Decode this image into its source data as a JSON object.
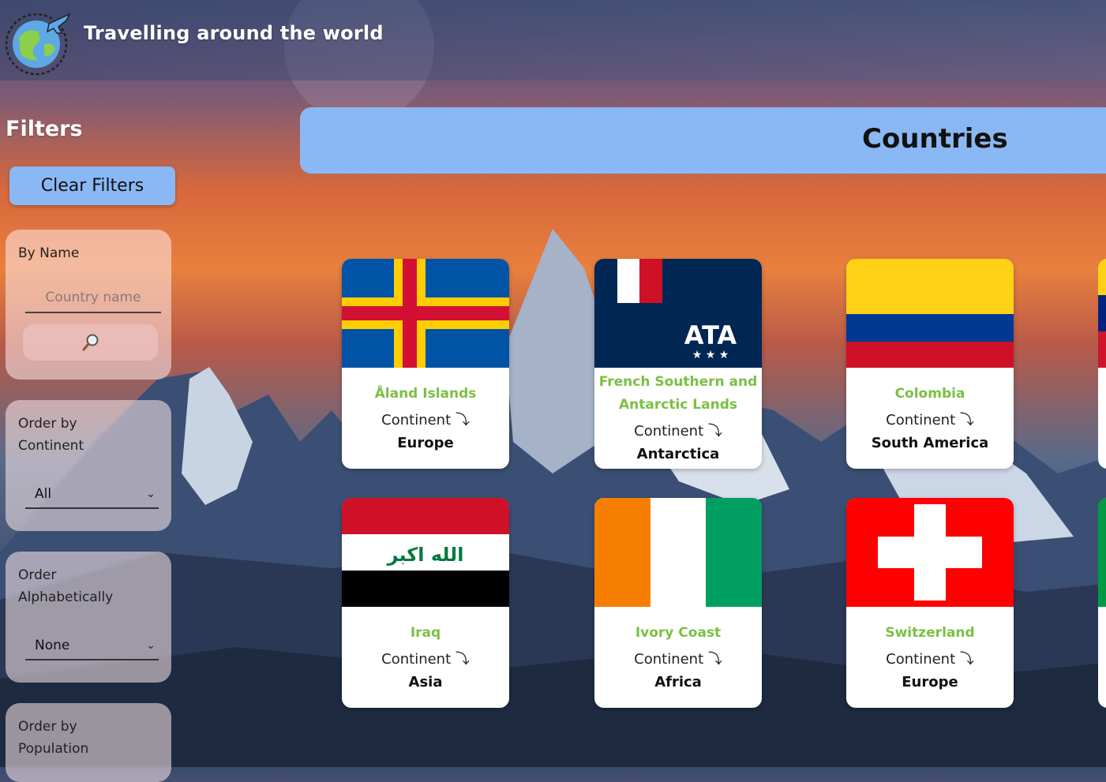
{
  "header": {
    "title": "Travelling around the world"
  },
  "icons": {
    "logo": "globe-plane-icon",
    "search": "magnifier-icon",
    "select_arrow": "chevron-down-icon"
  },
  "filters": {
    "title": "Filters",
    "clear_label": "Clear Filters",
    "by_name": {
      "label": "By Name",
      "placeholder": "Country name"
    },
    "order_continent": {
      "label_line1": "Order by",
      "label_line2": "Continent",
      "selected": "All"
    },
    "order_alpha": {
      "label_line1": "Order",
      "label_line2": "Alphabetically",
      "selected": "None"
    },
    "order_population": {
      "label_line1": "Order by",
      "label_line2": "Population"
    }
  },
  "main": {
    "title": "Countries"
  },
  "continent_label": "Continent ⤵",
  "countries": [
    {
      "name": "Åland Islands",
      "continent": "Europe",
      "flag": "aland"
    },
    {
      "name": "French Southern and Antarctic Lands",
      "continent": "Antarctica",
      "flag": "tf"
    },
    {
      "name": "Colombia",
      "continent": "South America",
      "flag": "colombia"
    },
    {
      "name": "Iraq",
      "continent": "Asia",
      "flag": "iraq"
    },
    {
      "name": "Ivory Coast",
      "continent": "Africa",
      "flag": "ivory"
    },
    {
      "name": "Switzerland",
      "continent": "Europe",
      "flag": "swiss"
    }
  ],
  "colors": {
    "accent": "#8ab8f4",
    "country_name": "#7bc043"
  }
}
